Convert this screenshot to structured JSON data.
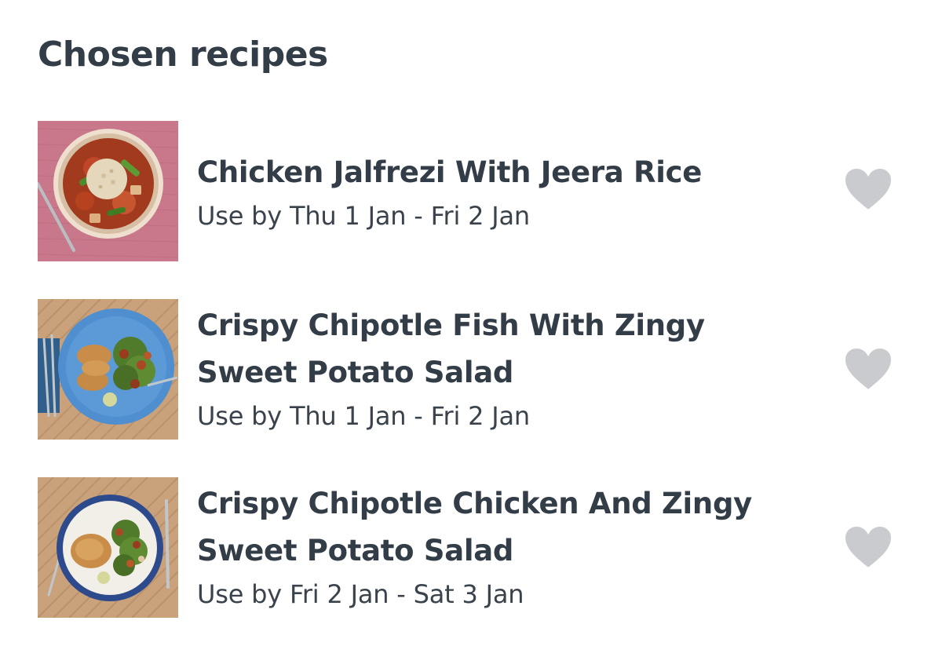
{
  "header": {
    "title": "Chosen recipes"
  },
  "recipes": [
    {
      "title": "Chicken Jalfrezi With Jeera Rice",
      "use_by": "Use by Thu 1 Jan - Fri 2 Jan",
      "image_icon": "curry-with-rice-plate"
    },
    {
      "title": "Crispy Chipotle Fish With Zingy Sweet Potato Salad",
      "use_by": "Use by Thu 1 Jan - Fri 2 Jan",
      "image_icon": "fish-and-salad-plate"
    },
    {
      "title": "Crispy Chipotle Chicken And Zingy Sweet Potato Salad",
      "use_by": "Use by Fri 2 Jan - Sat 3 Jan",
      "image_icon": "chicken-and-salad-plate"
    }
  ],
  "icons": {
    "favourite": "heart-icon"
  },
  "colors": {
    "text": "#333d47",
    "heart": "#c9cbcf",
    "pink_background": "#c96f83",
    "blue_plate": "#4f8fd0",
    "navy_plate": "#2c4a8c"
  }
}
